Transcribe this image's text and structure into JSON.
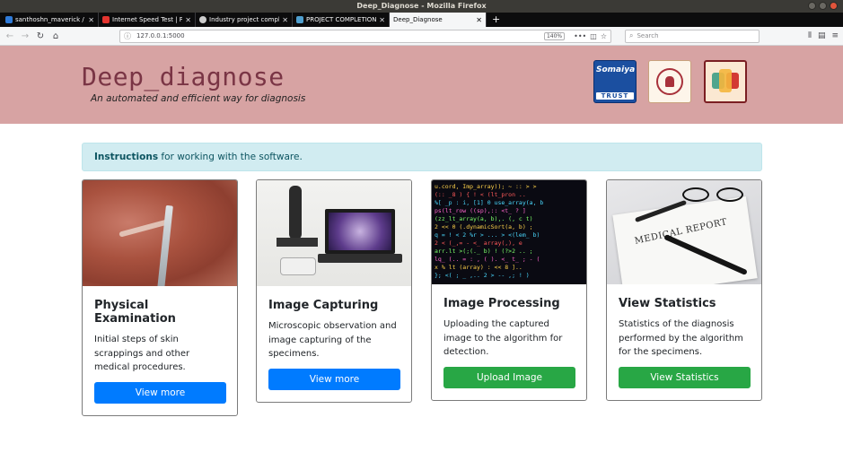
{
  "window": {
    "title": "Deep_Diagnose - Mozilla Firefox"
  },
  "tabs": [
    {
      "label": "santhoshn_maverick / d...",
      "favicon_color": "#2f7bd9"
    },
    {
      "label": "Internet Speed Test | Fa...",
      "favicon_color": "#e3342f"
    },
    {
      "label": "Industry project comple...",
      "favicon_color": "#cccccc"
    },
    {
      "label": "PROJECT COMPLETION ...",
      "favicon_color": "#4f9fcf"
    },
    {
      "label": "Deep_Diagnose",
      "favicon_color": "#f5f6f7",
      "active": true
    }
  ],
  "navbar": {
    "url": "127.0.0.1:5000",
    "zoom": "140%",
    "search_placeholder": "Search"
  },
  "header": {
    "title": "Deep_diagnose",
    "subtitle": "An automated and efficient way for diagnosis",
    "logos": [
      {
        "script": "Somaiya",
        "word": "TRUST"
      },
      {
        "name": "vidyavihar-logo"
      },
      {
        "name": "medical-logo"
      }
    ]
  },
  "instructions": {
    "bold": "Instructions",
    "text": " for working with the software."
  },
  "cards": [
    {
      "title": "Physical Examination",
      "text": "Initial steps of skin scrappings and other medical procedures.",
      "button": "View more",
      "button_style": "primary"
    },
    {
      "title": "Image Capturing",
      "text": "Microscopic observation and image capturing of the specimens.",
      "button": "View more",
      "button_style": "primary"
    },
    {
      "title": "Image Processing",
      "text": "Uploading the captured image to the algorithm for detection.",
      "button": "Upload Image",
      "button_style": "success"
    },
    {
      "title": "View Statistics",
      "text": "Statistics of the diagnosis performed by the algorithm for the specimens.",
      "button": "View Statistics",
      "button_style": "success"
    }
  ],
  "image_texts": {
    "report_title": "MEDICAL REPORT"
  },
  "colors": {
    "hero_bg": "#d7a3a3",
    "title_color": "#7a3545",
    "primary": "#007bff",
    "success": "#28a745",
    "alert_bg": "#d1ecf1"
  }
}
